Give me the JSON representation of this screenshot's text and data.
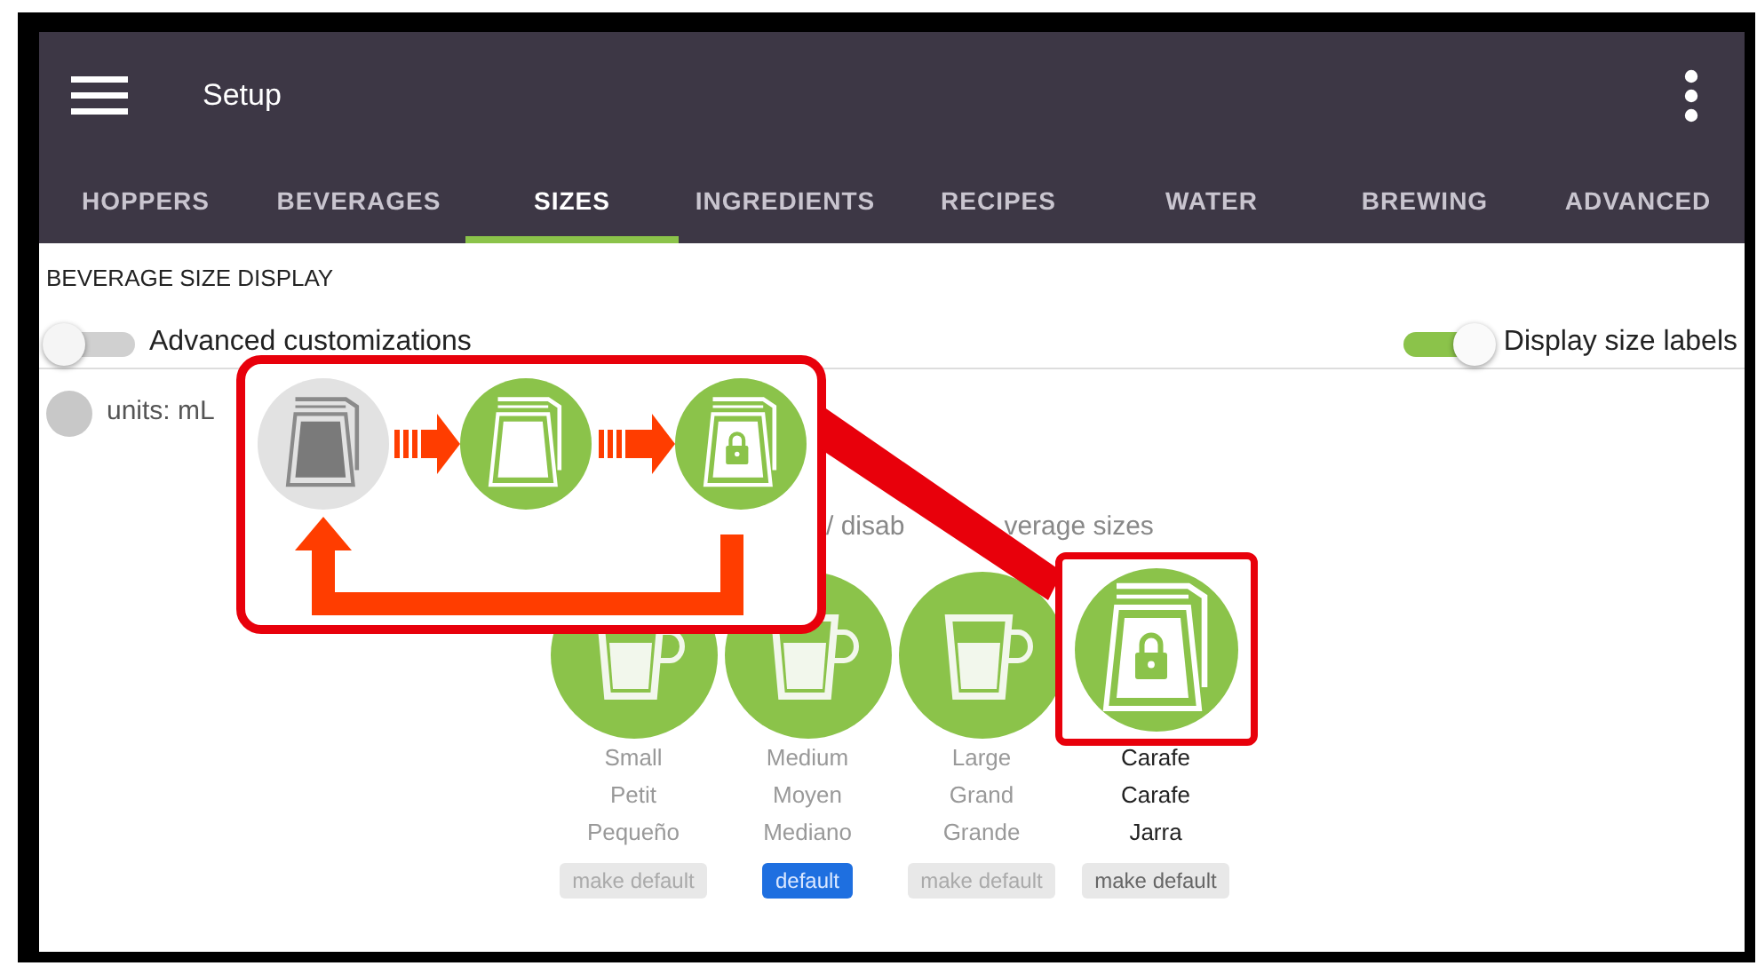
{
  "app_bar": {
    "title": "Setup"
  },
  "tabs": [
    {
      "label": "HOPPERS",
      "selected": false
    },
    {
      "label": "BEVERAGES",
      "selected": false
    },
    {
      "label": "SIZES",
      "selected": true
    },
    {
      "label": "INGREDIENTS",
      "selected": false
    },
    {
      "label": "RECIPES",
      "selected": false
    },
    {
      "label": "WATER",
      "selected": false
    },
    {
      "label": "BREWING",
      "selected": false
    },
    {
      "label": "ADVANCED",
      "selected": false
    }
  ],
  "section": {
    "title": "BEVERAGE SIZE DISPLAY"
  },
  "toggles": [
    {
      "label": "Advanced customizations",
      "on": false
    },
    {
      "label": "Display size labels",
      "on": true
    }
  ],
  "units": {
    "label": "units: mL",
    "on": false
  },
  "sizes_heading": {
    "parts": [
      "/ disab",
      "verage sizes"
    ]
  },
  "sizes": [
    {
      "kind": "cup",
      "labels": [
        "Small",
        "Petit",
        "Pequeño"
      ],
      "button": "make default",
      "default": false
    },
    {
      "kind": "cup",
      "labels": [
        "Medium",
        "Moyen",
        "Mediano"
      ],
      "button": "default",
      "default": true
    },
    {
      "kind": "cup",
      "labels": [
        "Large",
        "Grand",
        "Grande"
      ],
      "button": "make default",
      "default": false
    },
    {
      "kind": "carafe",
      "labels": [
        "Carafe",
        "Carafe",
        "Jarra"
      ],
      "button": "make default",
      "default": false
    }
  ],
  "callout": {
    "states": [
      {
        "kind": "disabled"
      },
      {
        "kind": "enabled"
      },
      {
        "kind": "locked"
      }
    ]
  }
}
